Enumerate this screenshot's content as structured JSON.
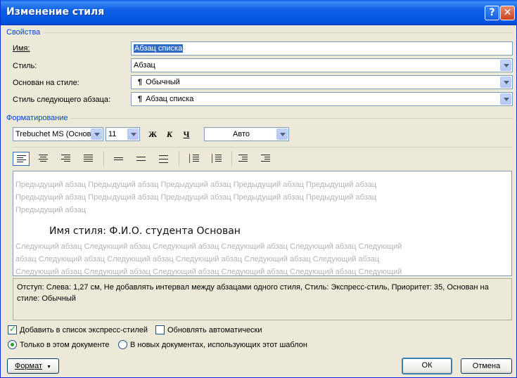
{
  "window": {
    "title": "Изменение стиля",
    "help_icon": "?",
    "close_icon": "✕"
  },
  "properties": {
    "section_label": "Свойства",
    "name_label": "Имя:",
    "name_value": "Абзац списка",
    "style_label": "Стиль:",
    "style_value": "Абзац",
    "based_on_label": "Основан на стиле:",
    "based_on_value": "Обычный",
    "next_style_label": "Стиль следующего абзаца:",
    "next_style_value": "Абзац списка",
    "paragraph_mark": "¶"
  },
  "formatting": {
    "section_label": "Форматирование",
    "font_name": "Trebuchet MS (Основ",
    "font_size": "11",
    "bold_label": "Ж",
    "italic_label": "К",
    "underline_label": "Ч",
    "color_value": "Авто"
  },
  "preview": {
    "prev_line1": "Предыдущий абзац Предыдущий абзац Предыдущий абзац Предыдущий абзац Предыдущий абзац",
    "prev_line2": "Предыдущий абзац Предыдущий абзац Предыдущий абзац Предыдущий абзац Предыдущий абзац",
    "prev_line3": "Предыдущий абзац",
    "sample_text": "Имя стиля: Ф.И.О. студента Основан",
    "next_line1": "Следующий абзац Следующий абзац Следующий абзац Следующий абзац Следующий абзац Следующий",
    "next_line2": "абзац Следующий абзац Следующий абзац Следующий абзац Следующий абзац Следующий абзац",
    "next_line3": "Следующий абзац Следующий абзац Следующий абзац Следующий абзац Следующий абзац Следующий"
  },
  "description": "Отступ: Слева:  1,27 см, Не добавлять интервал между абзацами одного стиля, Стиль: Экспресс-стиль, Приоритет: 35, Основан на стиле: Обычный",
  "options": {
    "add_to_quick_styles": "Добавить в список экспресс-стилей",
    "auto_update": "Обновлять автоматически",
    "only_this_document": "Только в этом документе",
    "new_documents": "В новых документах, использующих этот шаблон"
  },
  "buttons": {
    "format": "Формат",
    "format_arrow": "▼",
    "ok": "ОК",
    "cancel": "Отмена"
  }
}
